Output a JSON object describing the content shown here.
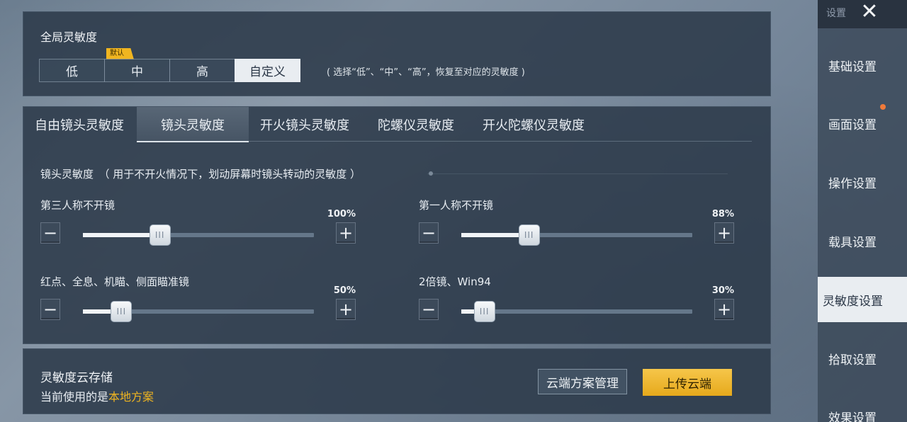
{
  "global": {
    "title": "全局灵敏度",
    "default_badge": "默认",
    "options": [
      "低",
      "中",
      "高",
      "自定义"
    ],
    "active_option": "自定义",
    "hint": "( 选择“低”、“中”、“高”，恢复至对应的灵敏度 )"
  },
  "tabs": {
    "items": [
      "自由镜头灵敏度",
      "镜头灵敏度",
      "开火镜头灵敏度",
      "陀螺仪灵敏度",
      "开火陀螺仪灵敏度"
    ],
    "active": "镜头灵敏度"
  },
  "section": {
    "title": "镜头灵敏度　（ 用于不开火情况下，划动屏幕时镜头转动的灵敏度 ）"
  },
  "sliders": [
    {
      "label": "第三人称不开镜",
      "percent_text": "100%",
      "value": 100
    },
    {
      "label": "第一人称不开镜",
      "percent_text": "88%",
      "value": 88
    },
    {
      "label": "红点、全息、机瞄、侧面瞄准镜",
      "percent_text": "50%",
      "value": 50
    },
    {
      "label": "2倍镜、Win94",
      "percent_text": "30%",
      "value": 30
    }
  ],
  "slider_max": 300,
  "cloud": {
    "title": "灵敏度云存储",
    "current_prefix": "当前使用的是",
    "current_value": "本地方案",
    "manage_label": "云端方案管理",
    "upload_label": "上传云端"
  },
  "sidebar": {
    "header": "设置",
    "items": [
      "基础设置",
      "画面设置",
      "操作设置",
      "载具设置",
      "灵敏度设置",
      "拾取设置",
      "效果设置"
    ],
    "active": "灵敏度设置"
  },
  "colors": {
    "accent": "#f0b520",
    "active_bg": "#e9edf1",
    "notify": "#f07a3a"
  }
}
